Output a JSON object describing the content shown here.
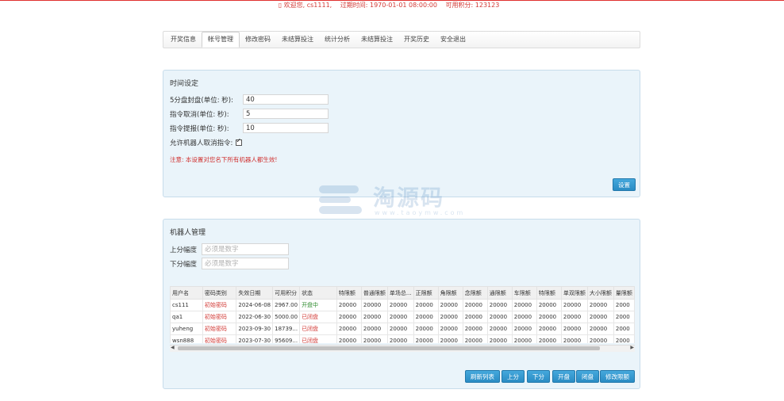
{
  "header": {
    "welcome_label": "欢迎您,",
    "username": "cs1111,",
    "expire_label": "过期时间:",
    "expire_value": "1970-01-01 08:00:00",
    "points_label": "可用积分:",
    "points_value": "123123"
  },
  "nav": {
    "tabs": [
      "开奖信息",
      "帐号管理",
      "修改密码",
      "未结算投注",
      "统计分析",
      "未结算投注",
      "开奖历史",
      "安全退出"
    ],
    "active_index": 1
  },
  "time_settings": {
    "title": "时间设定",
    "fields": [
      {
        "label": "5分盘封盘(单位: 秒):",
        "value": "40"
      },
      {
        "label": "指令取消(单位: 秒):",
        "value": "5"
      },
      {
        "label": "指令提报(单位: 秒):",
        "value": "10"
      }
    ],
    "allow_cancel_label": "允许机器人取消指令:",
    "allow_cancel_checked": true,
    "notice": "注意: 本设置对您名下所有机器人都生效!",
    "set_button": "设置"
  },
  "robot": {
    "title": "机器人管理",
    "up_label": "上分幅度",
    "up_placeholder": "必须是数字",
    "down_label": "下分幅度",
    "down_placeholder": "必须是数字",
    "columns": [
      "用户名",
      "密码类别",
      "失效日期",
      "可用积分",
      "状态",
      "特限额",
      "普通限额",
      "单场总...",
      "正限额",
      "角限额",
      "念限额",
      "通限额",
      "车限额",
      "特限额",
      "单双限额",
      "大小限额",
      "量限额"
    ],
    "rows": [
      [
        "cs111",
        "初始密码",
        "2024-06-08",
        "2967.00",
        "开盘中",
        "20000",
        "20000",
        "20000",
        "20000",
        "20000",
        "20000",
        "20000",
        "20000",
        "20000",
        "20000",
        "20000",
        "2000"
      ],
      [
        "qa1",
        "初始密码",
        "2022-06-30",
        "5000.00",
        "已闭盘",
        "20000",
        "20000",
        "20000",
        "20000",
        "20000",
        "20000",
        "20000",
        "20000",
        "20000",
        "20000",
        "20000",
        "2000"
      ],
      [
        "yuheng",
        "初始密码",
        "2023-09-30",
        "18739...",
        "已闭盘",
        "20000",
        "20000",
        "20000",
        "20000",
        "20000",
        "20000",
        "20000",
        "20000",
        "20000",
        "20000",
        "20000",
        "2000"
      ],
      [
        "wsn888",
        "初始密码",
        "2023-07-30",
        "95609...",
        "已闭盘",
        "20000",
        "20000",
        "20000",
        "20000",
        "20000",
        "20000",
        "20000",
        "20000",
        "20000",
        "20000",
        "20000",
        "2000"
      ]
    ],
    "buttons": [
      "刷新列表",
      "上分",
      "下分",
      "开盘",
      "闭盘",
      "修改限额"
    ]
  },
  "watermark": {
    "text": "淘源码",
    "sub": "www.taoymw.com"
  },
  "colors": {
    "accent": "#2a8cc4",
    "alert": "#d23a36",
    "panel_bg": "#eaf4fa"
  }
}
